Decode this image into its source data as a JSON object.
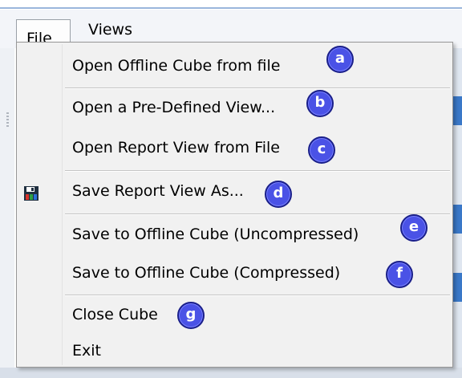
{
  "menubar": {
    "file_label": "File",
    "views_label": "Views"
  },
  "file_menu": {
    "items": [
      {
        "label": "Open Offline Cube from file",
        "badge": "a"
      },
      {
        "label": "Open a Pre-Defined View...",
        "badge": "b"
      },
      {
        "label": "Open Report View from File",
        "badge": "c"
      },
      {
        "label": "Save Report View As...",
        "badge": "d",
        "icon": "save-icon"
      },
      {
        "label": "Save to Offline Cube (Uncompressed)",
        "badge": "e"
      },
      {
        "label": "Save to Offline Cube (Compressed)",
        "badge": "f"
      },
      {
        "label": "Close Cube",
        "badge": "g"
      },
      {
        "label": "Exit"
      }
    ]
  },
  "colors": {
    "badge_fill": "#4a52e6",
    "badge_border": "#1a1f8a",
    "menu_background": "#f1f1f1",
    "accent_blue": "#3a78c8"
  }
}
